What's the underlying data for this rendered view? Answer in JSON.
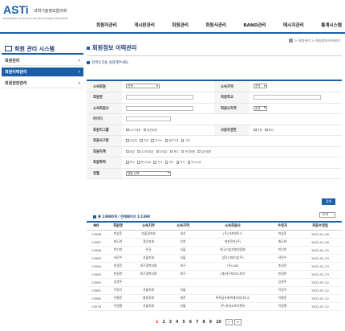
{
  "header": {
    "logo_mark": "ASTi",
    "logo_kr": "과학기술정보협의회",
    "logo_en": "Association of Science and Technology Information",
    "nav": [
      "회원자관리",
      "게시판관리",
      "회원관리",
      "회원사관리",
      "BAND관리",
      "메시지관리",
      "통계시스템"
    ]
  },
  "breadcrumb": "> 회원관리 > 회원정보이력관리",
  "sidebar": {
    "title": "회원 관리 시스템",
    "items": [
      {
        "label": "회원관리"
      },
      {
        "label": "회원이력관리"
      },
      {
        "label": "회원권한관리"
      }
    ]
  },
  "main": {
    "title": "회원정보 이력관리",
    "notice": "검색조건을 설정해주세요.",
    "form": {
      "org_label": "소속회원",
      "org_value": "전체",
      "region_label": "소속지역",
      "region_value": "전국",
      "name_label": "회원명",
      "school_label": "최종학교",
      "dept_label": "소속회원사",
      "industry_label": "회원사지역",
      "industry_value": "전국",
      "id_label": "아이디",
      "recv_label": "회원지그룹",
      "recv_opts": [
        "LG기계회",
        "일반회원"
      ],
      "kind_label": "사용자권한",
      "kind_opts": [
        "사용",
        "폐지"
      ],
      "area_label": "회원사구분",
      "area_opts": [
        "산업계",
        "학계",
        "연구소",
        "정부기관",
        "기타"
      ],
      "job_label": "회원직책",
      "job_opts": [
        "회장",
        "수석부회장",
        "부회장",
        "총무",
        "운영위원",
        "일반회원"
      ],
      "degree_label": "회원학력",
      "degree_opts": [
        "학사",
        "학사수료",
        "석사",
        "기타",
        "박사",
        "미사수료"
      ],
      "sort_label": "정렬",
      "sort_value": "정렬 선택"
    },
    "search_button": "검색",
    "summary": "총 13980개 / 전체페이지 1/1398",
    "page_size": "10개",
    "table": {
      "headers": [
        "NO",
        "회원명",
        "소속지부",
        "소속지역",
        "소속회원사",
        "수정자",
        "최종수정일"
      ],
      "rows": [
        [
          "13088",
          "박상준",
          "부울경지회",
          "부산",
          "(주)가지데이스",
          "박상준",
          "2022.01.26"
        ],
        [
          "13087",
          "최도현",
          "경인지회",
          "인천",
          "대한전자(주)",
          "최도현",
          "2022.01.26"
        ],
        [
          "13086",
          "박기연",
          "전국",
          "서울",
          "한국기업지원연합회",
          "박기연",
          "2022.01.25"
        ],
        [
          "13085",
          "서민수",
          "서울지회",
          "서울",
          "업진소재산업(주)",
          "서민수",
          "2022.01.23"
        ],
        [
          "13084",
          "손경진",
          "대구경북지회",
          "대구",
          "(주)LAB",
          "손경진",
          "2022.01.23"
        ],
        [
          "13083",
          "한길한",
          "대구경북지회",
          "대구",
          "(재)대구테크노파크",
          "한길한",
          "2022.01.23"
        ],
        [
          "13082",
          "김영주",
          "",
          "",
          "",
          "김영주",
          "2022.01.22"
        ],
        [
          "13081",
          "이성식",
          "서울지회",
          "서울",
          "",
          "이성식",
          "2022.01.22"
        ],
        [
          "13080",
          "이형준",
          "충청지회",
          "대전",
          "특허공유회복제조업사무소",
          "이형준",
          "2022.01.22"
        ],
        [
          "13079",
          "이영철",
          "서울지회",
          "서울",
          "(주)유네소프리엔터",
          "이영철",
          "2022.01.22"
        ]
      ]
    },
    "pager": [
      "1",
      "2",
      "3",
      "4",
      "5",
      "6",
      "7",
      "8",
      "9",
      "10"
    ],
    "pager_next": "›",
    "pager_last": "»"
  },
  "colors": {
    "brand": "#1a5ea8",
    "accent": "#e8332a"
  }
}
